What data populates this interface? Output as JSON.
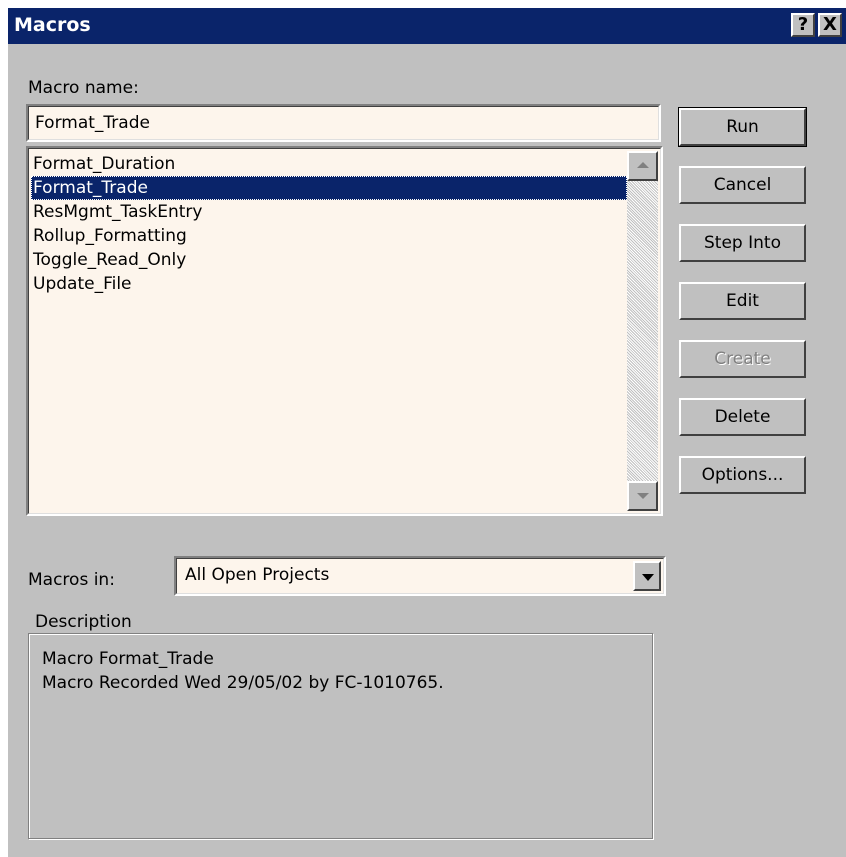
{
  "window": {
    "title": "Macros",
    "help_label": "?",
    "close_label": "X"
  },
  "macro_name": {
    "label": "Macro name:",
    "value": "Format_Trade"
  },
  "macro_list": {
    "items": [
      {
        "label": "Format_Duration",
        "selected": false
      },
      {
        "label": "Format_Trade",
        "selected": true
      },
      {
        "label": "ResMgmt_TaskEntry",
        "selected": false
      },
      {
        "label": "Rollup_Formatting",
        "selected": false
      },
      {
        "label": "Toggle_Read_Only",
        "selected": false
      },
      {
        "label": "Update_File",
        "selected": false
      }
    ]
  },
  "buttons": {
    "run": "Run",
    "cancel": "Cancel",
    "step_into": "Step Into",
    "edit": "Edit",
    "create": "Create",
    "delete": "Delete",
    "options": "Options..."
  },
  "macros_in": {
    "label": "Macros in:",
    "value": "All Open Projects"
  },
  "description": {
    "legend": "Description",
    "line1": "Macro Format_Trade",
    "line2": "Macro Recorded Wed 29/05/02 by FC-1010765."
  },
  "colors": {
    "title_bar": "#0a246a",
    "dialog_face": "#c0c0c0",
    "field_background": "#fdf5ec",
    "selection": "#0a246a"
  }
}
